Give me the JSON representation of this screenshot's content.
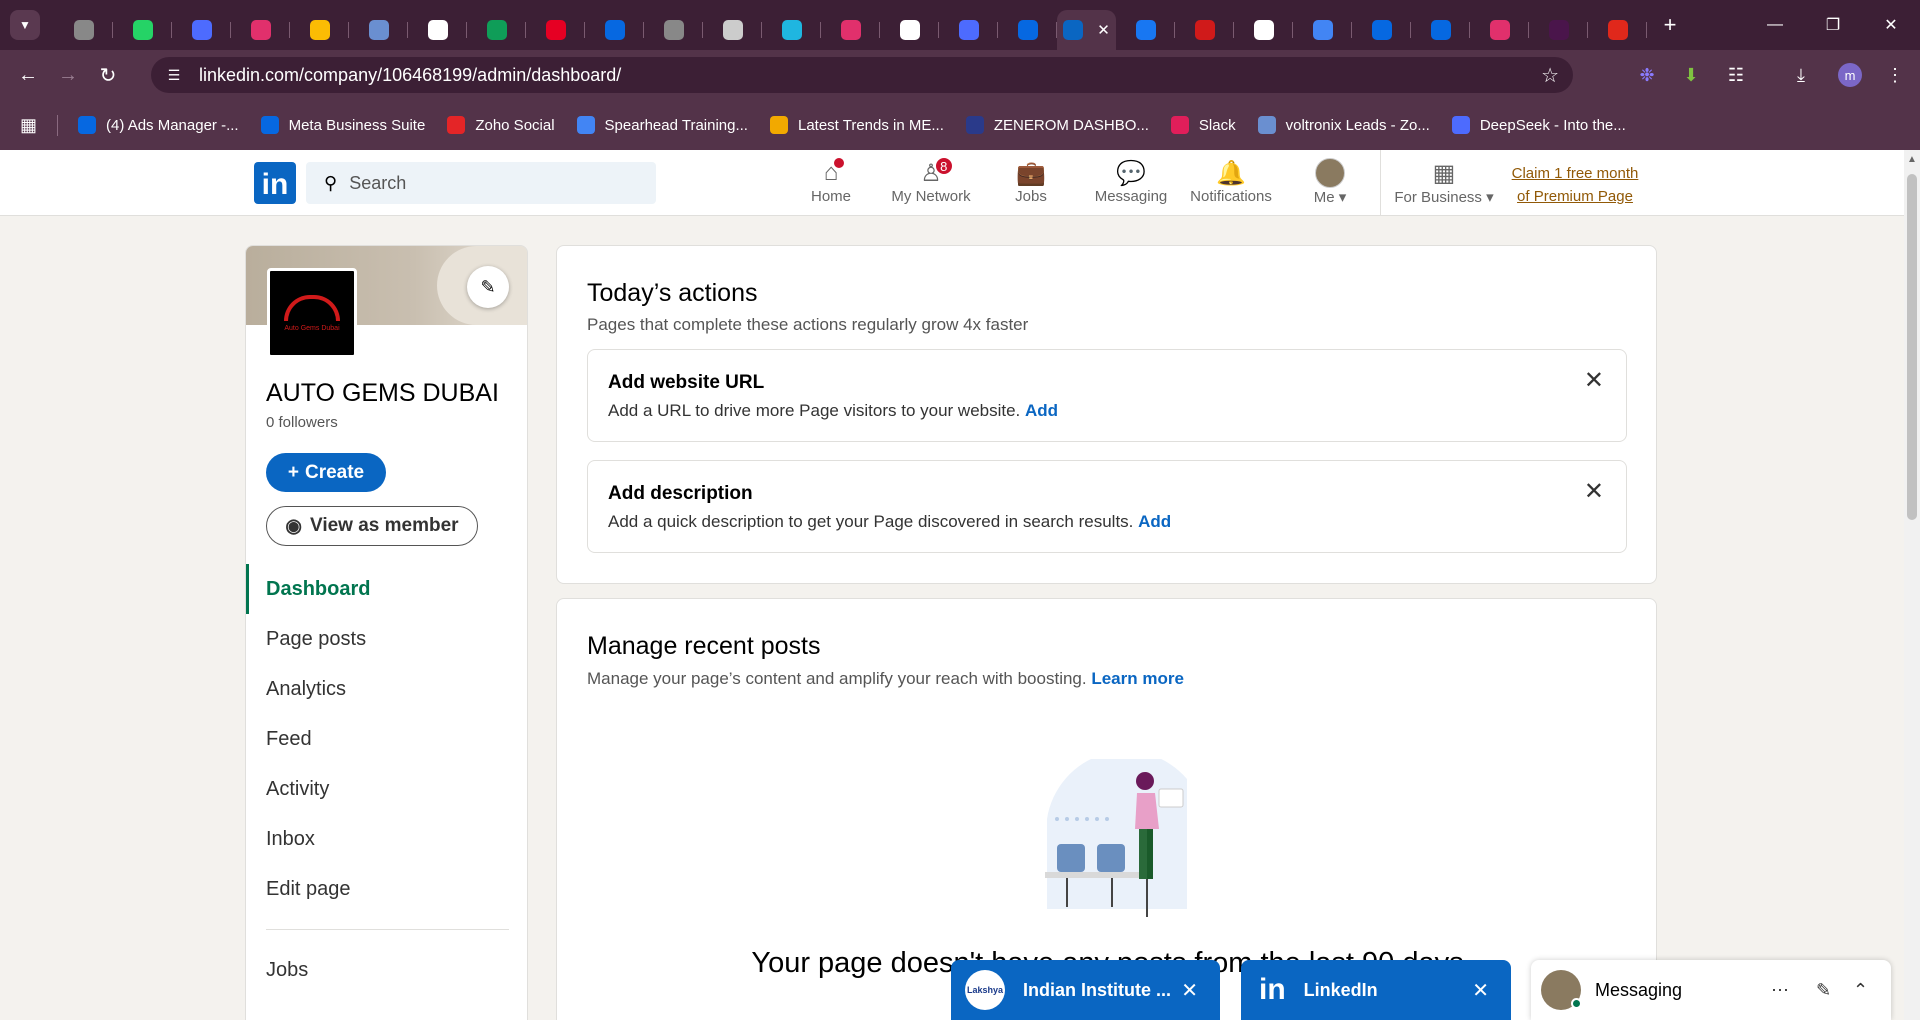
{
  "browser": {
    "url": "linkedin.com/company/106468199/admin/dashboard/",
    "profile_initial": "m",
    "tabs": [
      {
        "icon": "globe-icon",
        "color": "#888888"
      },
      {
        "icon": "whatsapp-business-icon",
        "color": "#25d366"
      },
      {
        "icon": "deepseek-icon",
        "color": "#4d6bfe"
      },
      {
        "icon": "instagram-icon",
        "color": "#e1306c"
      },
      {
        "icon": "google-ads-icon",
        "color": "#fbbc04"
      },
      {
        "icon": "voltronix-icon",
        "color": "#6a8fd0"
      },
      {
        "icon": "chatgpt-icon",
        "color": "#ffffff"
      },
      {
        "icon": "google-sheets-icon",
        "color": "#0f9d58"
      },
      {
        "icon": "pinterest-icon",
        "color": "#e60023"
      },
      {
        "icon": "meta-icon",
        "color": "#0668e1"
      },
      {
        "icon": "globe-icon",
        "color": "#888888"
      },
      {
        "icon": "history-icon",
        "color": "#cccccc"
      },
      {
        "icon": "zoho-icon",
        "color": "#1fb6e0"
      },
      {
        "icon": "instagram-icon",
        "color": "#e1306c"
      },
      {
        "icon": "xai-icon",
        "color": "#ffffff"
      },
      {
        "icon": "deepseek-icon",
        "color": "#4d6bfe"
      },
      {
        "icon": "meta-icon",
        "color": "#0668e1"
      },
      {
        "icon": "linkedin-icon",
        "color": "#0a66c2"
      },
      {
        "icon": "facebook-icon",
        "color": "#1877f2"
      },
      {
        "icon": "car-icon",
        "color": "#d01a1a"
      },
      {
        "icon": "x-icon",
        "color": "#ffffff"
      },
      {
        "icon": "google-icon",
        "color": "#4285f4"
      },
      {
        "icon": "meta-icon",
        "color": "#0668e1"
      },
      {
        "icon": "meta-icon",
        "color": "#0668e1"
      },
      {
        "icon": "instagram-icon",
        "color": "#e1306c"
      },
      {
        "icon": "slack-icon",
        "color": "#4a154b"
      },
      {
        "icon": "acrobat-icon",
        "color": "#e0281b"
      }
    ],
    "bookmarks": [
      {
        "label": "(4) Ads Manager -...",
        "icon": "meta-icon",
        "color": "#0668e1"
      },
      {
        "label": "Meta Business Suite",
        "icon": "meta-icon",
        "color": "#0668e1"
      },
      {
        "label": "Zoho Social",
        "icon": "zoho-social-icon",
        "color": "#e42527"
      },
      {
        "label": "Spearhead Training...",
        "icon": "google-icon",
        "color": "#4285f4"
      },
      {
        "label": "Latest Trends in ME...",
        "icon": "link-icon",
        "color": "#f2a900"
      },
      {
        "label": "ZENEROM DASHBO...",
        "icon": "zenerom-icon",
        "color": "#2a3a8a"
      },
      {
        "label": "Slack",
        "icon": "slack-icon",
        "color": "#e01e5a"
      },
      {
        "label": "voltronix Leads - Zo...",
        "icon": "voltronix-icon",
        "color": "#6a8fd0"
      },
      {
        "label": "DeepSeek - Into the...",
        "icon": "deepseek-icon",
        "color": "#4d6bfe"
      }
    ]
  },
  "nav": {
    "search_placeholder": "Search",
    "home": "Home",
    "network": "My Network",
    "network_badge": "8",
    "jobs": "Jobs",
    "messaging": "Messaging",
    "notifications": "Notifications",
    "me": "Me",
    "business": "For Business",
    "premium_line1": "Claim 1 free month",
    "premium_line2": "of Premium Page"
  },
  "company": {
    "name": "AUTO GEMS DUBAI",
    "followers": "0 followers",
    "logo_text": "Auto Gems Dubai",
    "create_label": "Create",
    "view_label": "View as member",
    "menu": [
      "Dashboard",
      "Page posts",
      "Analytics",
      "Feed",
      "Activity",
      "Inbox",
      "Edit page"
    ],
    "menu_extra": "Jobs"
  },
  "actions": {
    "title": "Today’s actions",
    "subtitle": "Pages that complete these actions regularly grow 4x faster",
    "items": [
      {
        "title": "Add website URL",
        "desc": "Add a URL to drive more Page visitors to your website.",
        "link": "Add"
      },
      {
        "title": "Add description",
        "desc": "Add a quick description to get your Page discovered in search results.",
        "link": "Add"
      }
    ]
  },
  "posts": {
    "title": "Manage recent posts",
    "subtitle": "Manage your page’s content and amplify your reach with boosting.",
    "learn_more": "Learn more",
    "empty_title": "Your page doesn't have any posts from the last 90 days"
  },
  "chats": [
    {
      "title": "Indian Institute ...",
      "logo": "Lakshya"
    },
    {
      "title": "LinkedIn"
    }
  ],
  "messaging_panel": "Messaging"
}
